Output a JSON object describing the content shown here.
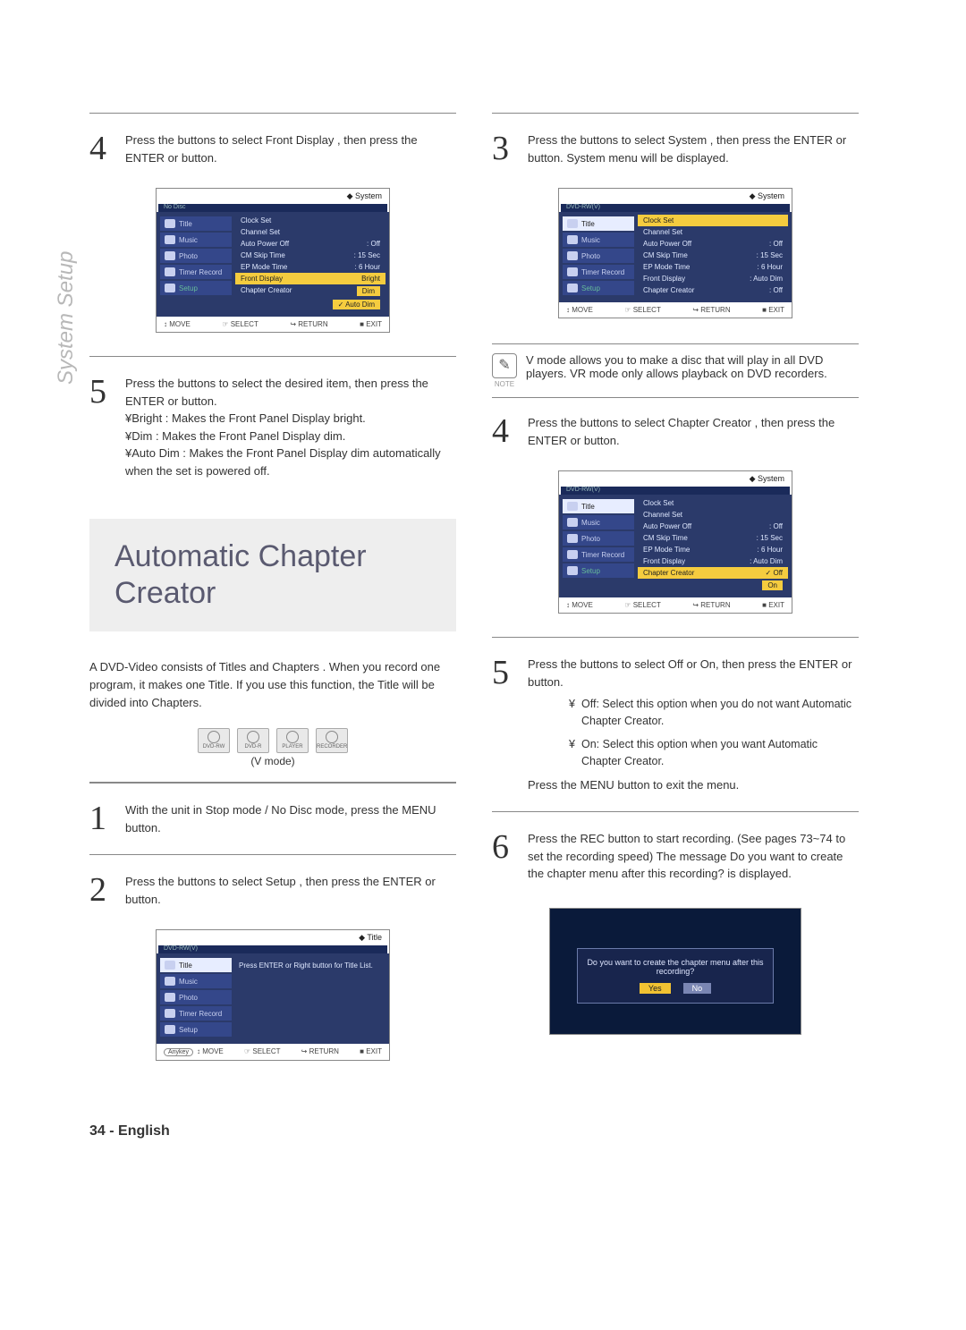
{
  "sidebar_label": "System Setup",
  "left": {
    "step4": "Press the   buttons to select Front Display , then press the ENTER or   button.",
    "step5_main": "Press the   buttons to select the desired item, then press the ENTER or   button.",
    "step5_b1": "¥Bright : Makes the Front Panel Display bright.",
    "step5_b2": "¥Dim : Makes the Front Panel Display dim.",
    "step5_b3": "¥Auto Dim : Makes the Front Panel Display dim automatically when the set is powered off.",
    "heading": "Automatic Chapter Creator",
    "intro": "A DVD-Video consists of  Titles  and  Chapters . When you record one program, it makes one Title. If you use this function, the Title will be divided into Chapters.",
    "vmode": "(V mode)",
    "step1": "With the unit in Stop mode / No Disc mode, press the MENU button.",
    "step2": "Press the   buttons to select Setup , then press the ENTER or   button."
  },
  "right": {
    "step3": "Press the   buttons to select System , then press the ENTER or   button. System menu will be displayed.",
    "note": "V mode allows you to make a disc that will play in all DVD players. VR mode only allows playback on DVD recorders.",
    "note_label": "NOTE",
    "step4": "Press the   buttons to select Chapter Creator , then press the ENTER or   button.",
    "step5": "Press the   buttons to select Off or On, then press the ENTER or   button.",
    "bul_off": "Off: Select this option when you do not want Automatic Chapter Creator.",
    "bul_on": "On: Select this option when you want Automatic Chapter Creator.",
    "exit": "Press the MENU button to exit the menu.",
    "step6": "Press the REC button to start recording. (See pages 73~74 to set the recording speed) The message  Do you want to create the chapter menu after this recording?  is displayed.",
    "dialog_msg": "Do you want to create the chapter menu after this recording?",
    "dialog_yes": "Yes",
    "dialog_no": "No"
  },
  "osd": {
    "system": "System",
    "title": "Title",
    "disc_none": "No Disc",
    "disc_rwv": "DVD-RW(V)",
    "nav": {
      "title": "Title",
      "music": "Music",
      "photo": "Photo",
      "timer": "Timer Record",
      "setup": "Setup"
    },
    "rows": {
      "clock": "Clock Set",
      "channel": "Channel Set",
      "apo_k": "Auto Power Off",
      "apo_v": ": Off",
      "cm_k": "CM Skip Time",
      "cm_v": ": 15 Sec",
      "ep_k": "EP Mode Time",
      "ep_v": ": 6 Hour",
      "fd_k": "Front Display",
      "fd_v_bright": "Bright",
      "fd_v_auto": ": Auto Dim",
      "dim": "Dim",
      "autodim": "✓ Auto Dim",
      "cc_k": "Chapter Creator",
      "cc_v_off": ": Off",
      "cc_opt_off": "✓ Off",
      "cc_opt_on": "On"
    },
    "tip": "Press ENTER or Right button for Title List.",
    "foot": {
      "move": "MOVE",
      "select": "SELECT",
      "return": "RETURN",
      "exit": "EXIT",
      "anykey": "Anykey"
    },
    "glyph": {
      "arrows": "↕",
      "sel": "☞",
      "ret": "↪",
      "exit": "■"
    }
  },
  "media": {
    "dvdrw": "DVD-RW",
    "dvdr": "DVD-R",
    "player": "PLAYER",
    "recorder": "RECORDER"
  },
  "footer": "34 - English"
}
